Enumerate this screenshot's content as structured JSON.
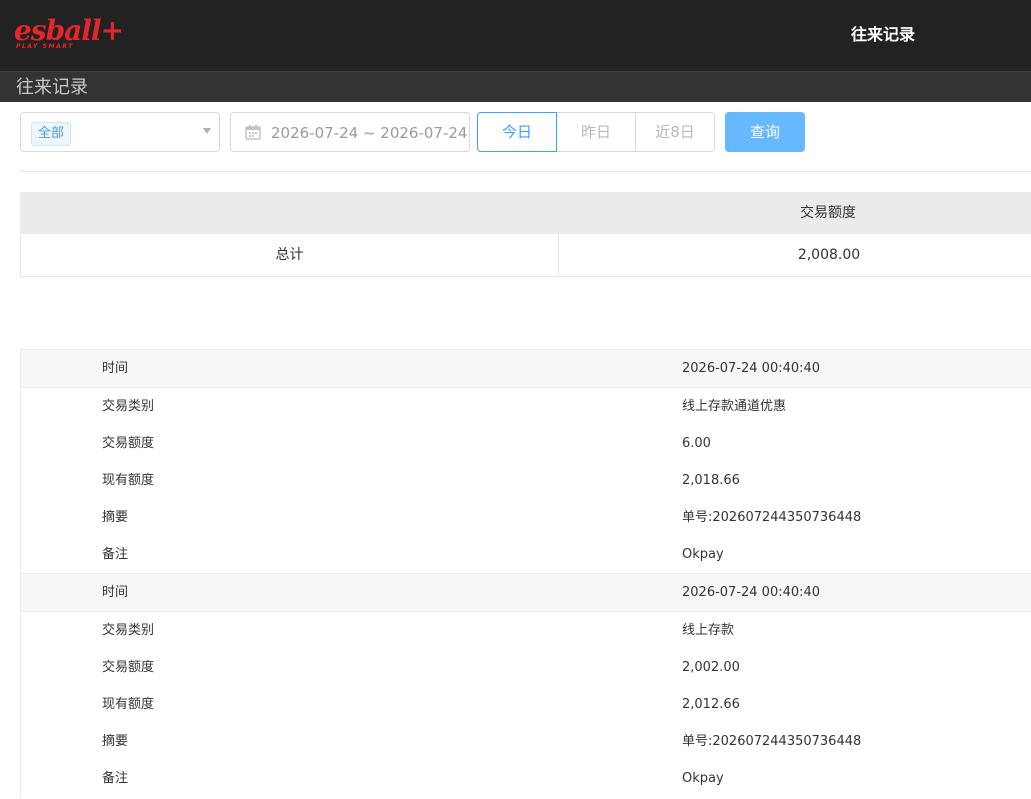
{
  "brand": {
    "logo_main": "esball+",
    "logo_sub": "PLAY SMART",
    "logo_color": "#e3262c"
  },
  "header": {
    "title": "往来记录"
  },
  "subheader": {
    "title": "往来记录"
  },
  "filters": {
    "category_tag": "全部",
    "date_range": "2026-07-24 ~ 2026-07-24",
    "quick_buttons": [
      {
        "label": "今日",
        "active": true
      },
      {
        "label": "昨日",
        "active": false
      },
      {
        "label": "近8日",
        "active": false
      }
    ],
    "query_label": "查询",
    "accent_color": "#409eff"
  },
  "summary": {
    "header_amount": "交易额度",
    "total_label": "总计",
    "total_value": "2,008.00"
  },
  "records": [
    {
      "fields": [
        {
          "label": "时间",
          "value": "2026-07-24 00:40:40"
        },
        {
          "label": "交易类别",
          "value": "线上存款通道优惠"
        },
        {
          "label": "交易额度",
          "value": "6.00"
        },
        {
          "label": "现有额度",
          "value": "2,018.66"
        },
        {
          "label": "摘要",
          "value": "单号:202607244350736448"
        },
        {
          "label": "备注",
          "value": "Okpay"
        }
      ]
    },
    {
      "fields": [
        {
          "label": "时间",
          "value": "2026-07-24 00:40:40"
        },
        {
          "label": "交易类别",
          "value": "线上存款"
        },
        {
          "label": "交易额度",
          "value": "2,002.00"
        },
        {
          "label": "现有额度",
          "value": "2,012.66"
        },
        {
          "label": "摘要",
          "value": "单号:202607244350736448"
        },
        {
          "label": "备注",
          "value": "Okpay"
        }
      ]
    }
  ]
}
